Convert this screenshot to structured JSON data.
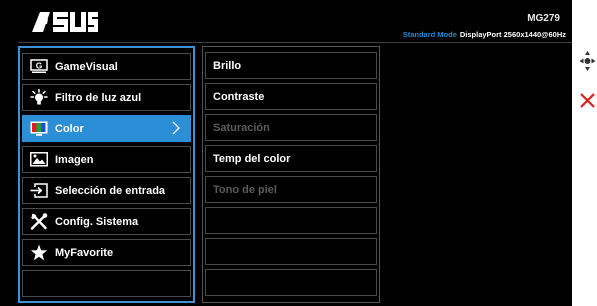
{
  "brand": "ASUS",
  "header": {
    "model": "MG279",
    "mode": "Standard Mode",
    "signal": "DisplayPort 2560x1440@60Hz"
  },
  "main_menu": [
    {
      "label": "GameVisual",
      "icon": "gamevisual-icon"
    },
    {
      "label": "Filtro de luz azul",
      "icon": "blue-light-filter-icon"
    },
    {
      "label": "Color",
      "icon": "color-icon",
      "selected": true
    },
    {
      "label": "Imagen",
      "icon": "image-icon"
    },
    {
      "label": "Selección de entrada",
      "icon": "input-select-icon"
    },
    {
      "label": "Config. Sistema",
      "icon": "system-setup-icon"
    },
    {
      "label": "MyFavorite",
      "icon": "star-icon"
    }
  ],
  "sub_menu": [
    {
      "label": "Brillo",
      "enabled": true
    },
    {
      "label": "Contraste",
      "enabled": true
    },
    {
      "label": "Saturación",
      "enabled": false
    },
    {
      "label": "Temp del color",
      "enabled": true
    },
    {
      "label": "Tono de piel",
      "enabled": false
    }
  ],
  "side_controls": {
    "nav": "navigation-joystick-icon",
    "close": "close-icon"
  },
  "colors": {
    "accent": "#2a8fd6",
    "background": "#000000",
    "close": "#e02020",
    "disabled": "#5c5c5c"
  }
}
